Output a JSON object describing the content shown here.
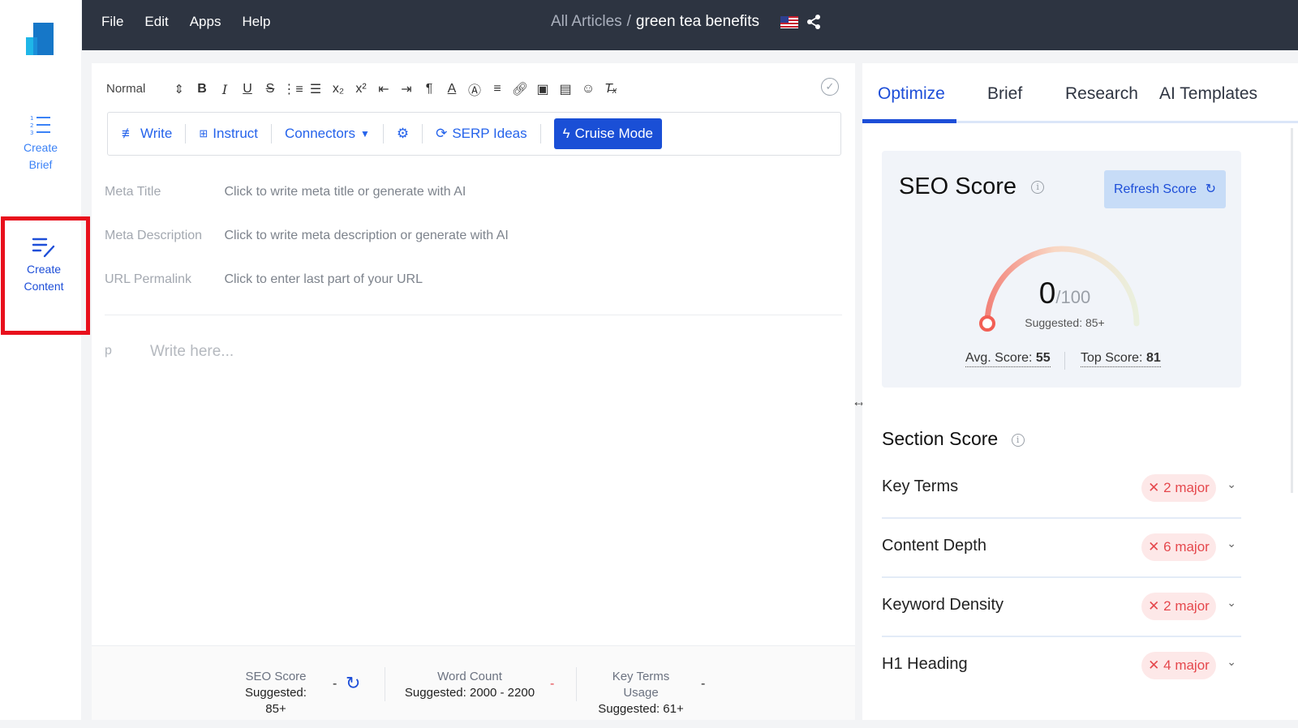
{
  "menu": [
    "File",
    "Edit",
    "Apps",
    "Help"
  ],
  "breadcrumb": {
    "parent": "All Articles",
    "sep": "/",
    "current": "green tea benefits"
  },
  "rail": {
    "brief": [
      "Create",
      "Brief"
    ],
    "content": [
      "Create",
      "Content"
    ]
  },
  "toolbar": {
    "style": "Normal",
    "write": "Write",
    "instruct": "Instruct",
    "connectors": "Connectors",
    "serp": "SERP Ideas",
    "cruise": "Cruise Mode"
  },
  "meta": {
    "title_label": "Meta Title",
    "title_ph": "Click to write meta title or generate with AI",
    "desc_label": "Meta Description",
    "desc_ph": "Click to write meta description or generate with AI",
    "url_label": "URL Permalink",
    "url_ph": "Click to enter last part of your URL"
  },
  "editor": {
    "para_tag": "p",
    "placeholder": "Write here..."
  },
  "statusbar": {
    "seo_title": "SEO Score",
    "seo_sugg": "Suggested: 85+",
    "seo_val": "-",
    "wc_title": "Word Count",
    "wc_sugg": "Suggested: 2000 - 2200",
    "wc_val": "-",
    "kt_title": "Key Terms Usage",
    "kt_sugg": "Suggested: 61+",
    "kt_val": "-"
  },
  "tabs": [
    "Optimize",
    "Brief",
    "Research",
    "AI Templates"
  ],
  "seo": {
    "title": "SEO Score",
    "refresh": "Refresh Score",
    "score": "0",
    "out_of": "/100",
    "suggested": "Suggested: 85+",
    "avg_label": "Avg. Score: ",
    "avg": "55",
    "top_label": "Top Score: ",
    "top": "81"
  },
  "section": {
    "title": "Section Score",
    "rows": [
      {
        "name": "Key Terms",
        "badge": "2 major"
      },
      {
        "name": "Content Depth",
        "badge": "6 major"
      },
      {
        "name": "Keyword Density",
        "badge": "2 major"
      },
      {
        "name": "H1 Heading",
        "badge": "4 major"
      }
    ]
  },
  "colors": {
    "accent": "#1d4ed8",
    "topbar": "#2d3441",
    "danger": "#e5484d",
    "highlight": "#e8101c"
  }
}
